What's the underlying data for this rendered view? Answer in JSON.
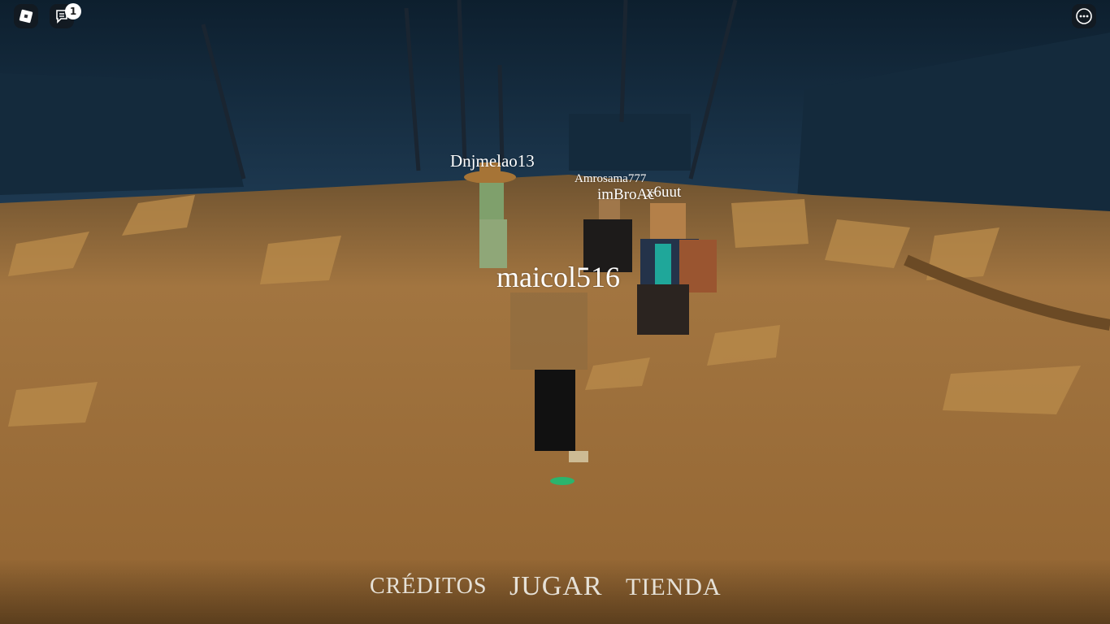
{
  "topbar": {
    "roblox_icon": "roblox-logo-icon",
    "chat_icon": "chat-icon",
    "chat_badge": "1",
    "more_icon": "more-options-icon"
  },
  "nametags": {
    "player_1": "Dnjmelao13",
    "player_2": "Amrosama777",
    "player_3": "imBroAc",
    "player_4": "x6uut",
    "local_player": "maicol516"
  },
  "menu": {
    "creditos": "CRÉDITOS",
    "jugar": "JUGAR",
    "tienda": "TIENDA"
  },
  "colors": {
    "sky": "#0f2233",
    "ground": "#a97a3e",
    "menu_text": "#e6e1d7"
  }
}
